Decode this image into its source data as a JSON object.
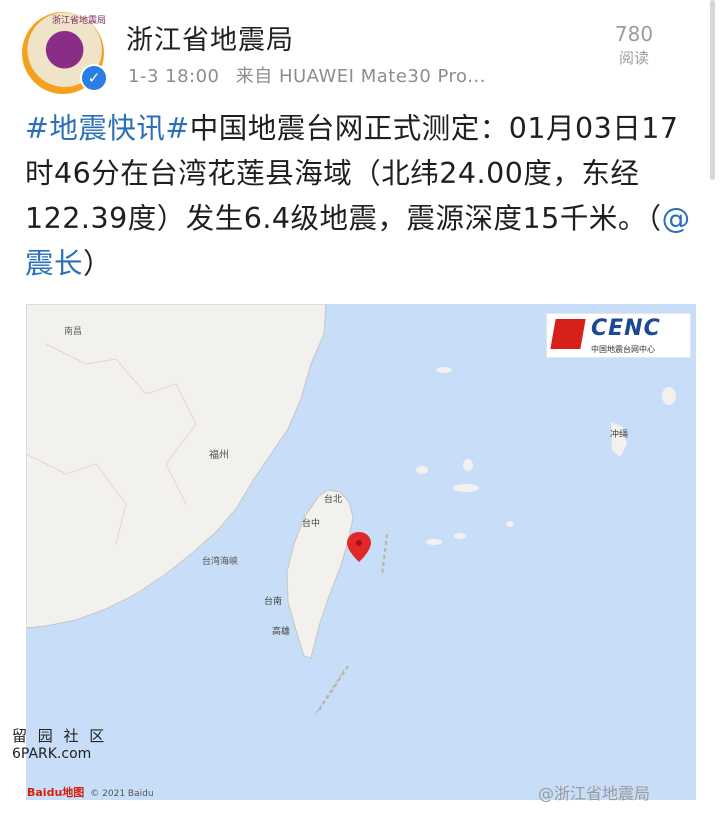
{
  "account": {
    "name": "浙江省地震局",
    "avatar_text": "浙江省地震局",
    "time": "1-3 18:00",
    "source": "来自 HUAWEI Mate30 Pro..."
  },
  "reads": {
    "count": "780",
    "label": "阅读"
  },
  "post": {
    "tag": "#地震快讯#",
    "body": "中国地震台网正式测定：01月03日17时46分在台湾花莲县海域（北纬24.00度，东经122.39度）发生6.4级地震，震源深度15千米。（",
    "mention": "@震长",
    "tail": "）"
  },
  "map": {
    "logo": "CENC",
    "logo_sub": "中国地震台网中心",
    "labels": {
      "nanchang": "南昌",
      "fuzhou": "福州",
      "taiwan_strait": "台湾海峡",
      "taipei": "台北",
      "taizhong": "台中",
      "tainan": "台南",
      "gaoxiong": "高雄",
      "okinawa": "冲绳"
    },
    "epicenter": {
      "lat": 24.0,
      "lon": 122.39
    },
    "baidu": "Baidu地图",
    "copyright": "© 2021 Baidu",
    "weibo_watermark": "@浙江省地震局"
  },
  "watermark": {
    "line1": "留 园 社 区",
    "line2": "6PARK.com"
  },
  "colors": {
    "link": "#2a6fb8",
    "sea": "#c8ddf7",
    "land": "#f2f1ee",
    "marker": "#e02828"
  }
}
